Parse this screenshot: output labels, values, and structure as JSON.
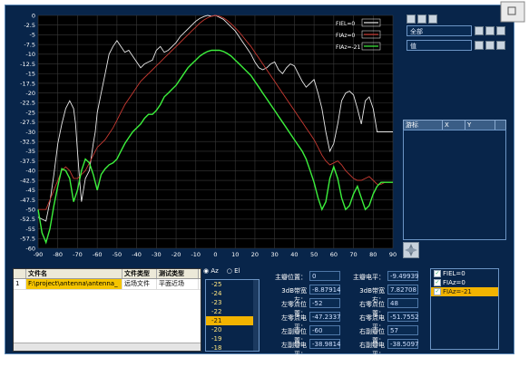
{
  "chart_data": {
    "type": "line",
    "xlim": [
      -90,
      90
    ],
    "ylim": [
      -60,
      0
    ],
    "x_ticks": [
      -90,
      -80,
      -70,
      -60,
      -50,
      -40,
      -30,
      -20,
      -10,
      0,
      10,
      20,
      30,
      40,
      50,
      60,
      70,
      80,
      90
    ],
    "y_ticks": [
      0,
      -2.5,
      -5,
      -7.5,
      -10,
      -12.5,
      -15,
      -17.5,
      -20,
      -22.5,
      -25,
      -27.5,
      -30,
      -32.5,
      -35,
      -37.5,
      -40,
      -42.5,
      -45,
      -47.5,
      -50,
      -52.5,
      -55,
      -57.5,
      -60
    ],
    "grid": true,
    "legend_position": "top-right",
    "series": [
      {
        "name": "FIEL=0",
        "color": "#e8e8e8",
        "x": [
          -90,
          -86,
          -84,
          -82,
          -80,
          -78,
          -76,
          -74,
          -72,
          -71,
          -70,
          -69,
          -68,
          -66,
          -64,
          -62,
          -61,
          -60,
          -58,
          -56,
          -54,
          -52,
          -50,
          -48,
          -46,
          -44,
          -42,
          -40,
          -38,
          -36,
          -34,
          -32,
          -30,
          -28,
          -26,
          -24,
          -22,
          -20,
          -18,
          -16,
          -14,
          -12,
          -10,
          -8,
          -6,
          -4,
          -2,
          0,
          2,
          4,
          6,
          8,
          10,
          12,
          14,
          16,
          18,
          20,
          22,
          24,
          26,
          28,
          30,
          32,
          34,
          36,
          38,
          40,
          42,
          44,
          46,
          48,
          50,
          52,
          54,
          56,
          58,
          60,
          62,
          64,
          66,
          68,
          70,
          72,
          74,
          76,
          78,
          80,
          82,
          84,
          86,
          88,
          90
        ],
        "y": [
          -52,
          -53,
          -48,
          -41,
          -33,
          -28,
          -24,
          -22,
          -24,
          -28,
          -35,
          -42,
          -48,
          -42,
          -40,
          -33,
          -30,
          -25,
          -20,
          -15,
          -10,
          -8,
          -6.5,
          -8,
          -9.5,
          -9,
          -10.5,
          -12,
          -13.5,
          -12.5,
          -12,
          -11.5,
          -9,
          -8,
          -9.5,
          -9,
          -8,
          -7,
          -5.5,
          -4.5,
          -3.5,
          -2.5,
          -1.5,
          -0.8,
          -0.3,
          0,
          -0.2,
          0,
          -0.5,
          -1,
          -2,
          -3,
          -4,
          -5.5,
          -7,
          -8.5,
          -10,
          -12,
          -13.5,
          -14,
          -13.5,
          -12.5,
          -12,
          -14,
          -15,
          -13.5,
          -12.5,
          -13,
          -15,
          -17,
          -18.5,
          -17.5,
          -16.5,
          -20,
          -24,
          -30,
          -35,
          -33,
          -28,
          -22,
          -20,
          -19.5,
          -20.5,
          -24,
          -28,
          -22,
          -21,
          -24,
          -30,
          -30,
          -30,
          -30,
          -30
        ]
      },
      {
        "name": "FIAz=0",
        "color": "#c83a32",
        "x": [
          -90,
          -86,
          -82,
          -78,
          -76,
          -74,
          -72,
          -70,
          -68,
          -66,
          -64,
          -62,
          -60,
          -58,
          -56,
          -54,
          -52,
          -50,
          -48,
          -46,
          -44,
          -42,
          -40,
          -38,
          -36,
          -34,
          -32,
          -30,
          -28,
          -26,
          -24,
          -22,
          -20,
          -18,
          -16,
          -14,
          -12,
          -10,
          -8,
          -6,
          -4,
          -2,
          0,
          2,
          4,
          6,
          8,
          10,
          12,
          14,
          16,
          18,
          20,
          22,
          24,
          26,
          28,
          30,
          32,
          34,
          36,
          38,
          40,
          42,
          44,
          46,
          48,
          50,
          52,
          54,
          56,
          58,
          60,
          62,
          64,
          66,
          68,
          70,
          72,
          74,
          76,
          78,
          80,
          82,
          84,
          86,
          88,
          90
        ],
        "y": [
          -50,
          -50,
          -45,
          -40,
          -39,
          -40,
          -42,
          -42,
          -41,
          -40,
          -38,
          -36,
          -34,
          -33,
          -32,
          -30.5,
          -29,
          -27,
          -25,
          -23,
          -21.5,
          -20,
          -18.5,
          -17,
          -16,
          -15,
          -14,
          -13,
          -12,
          -11,
          -10,
          -9,
          -8,
          -7,
          -6,
          -5,
          -4,
          -3,
          -2,
          -1.2,
          -0.6,
          -0.2,
          0,
          -0.2,
          -0.6,
          -1.3,
          -2.2,
          -3.2,
          -4.3,
          -5.5,
          -6.8,
          -8,
          -9.5,
          -11,
          -12.5,
          -14,
          -15.5,
          -17,
          -18.5,
          -20,
          -21.5,
          -23,
          -24.5,
          -26,
          -27.5,
          -29,
          -30.5,
          -32,
          -34,
          -36,
          -37.5,
          -38.5,
          -38,
          -37.5,
          -38.5,
          -40,
          -41,
          -42,
          -42.5,
          -42.5,
          -42,
          -41.5,
          -42.5,
          -43.5,
          -43.5,
          -43,
          -43,
          -43
        ]
      },
      {
        "name": "FIAz=-21",
        "color": "#3cf03c",
        "x": [
          -90,
          -88,
          -86,
          -84,
          -82,
          -80,
          -78,
          -76,
          -74,
          -72,
          -70,
          -68,
          -66,
          -64,
          -62,
          -60,
          -58,
          -56,
          -54,
          -52,
          -50,
          -48,
          -46,
          -44,
          -42,
          -40,
          -38,
          -36,
          -34,
          -32,
          -30,
          -28,
          -26,
          -24,
          -22,
          -20,
          -18,
          -16,
          -14,
          -12,
          -10,
          -8,
          -6,
          -4,
          -2,
          0,
          2,
          4,
          6,
          8,
          10,
          12,
          14,
          16,
          18,
          20,
          22,
          24,
          26,
          28,
          30,
          32,
          34,
          36,
          38,
          40,
          42,
          44,
          46,
          48,
          50,
          52,
          54,
          56,
          58,
          60,
          62,
          64,
          66,
          68,
          70,
          72,
          74,
          76,
          78,
          80,
          82,
          84,
          86,
          88,
          90
        ],
        "y": [
          -50,
          -56,
          -58.5,
          -55,
          -49,
          -44,
          -39.5,
          -40,
          -42,
          -48,
          -45,
          -40,
          -37,
          -38,
          -41,
          -45,
          -41,
          -39.5,
          -38.5,
          -38,
          -37,
          -35,
          -33,
          -31.5,
          -30,
          -29,
          -28,
          -26.5,
          -25.5,
          -25.5,
          -24.5,
          -23,
          -21,
          -20,
          -19,
          -18,
          -16.5,
          -15,
          -13.5,
          -12.5,
          -11.5,
          -10.5,
          -9.8,
          -9.3,
          -9,
          -9,
          -9,
          -9.3,
          -9.8,
          -10.5,
          -11.5,
          -12.5,
          -13.5,
          -14.5,
          -15.5,
          -17,
          -18.5,
          -20,
          -21.5,
          -23,
          -24.5,
          -26,
          -27.5,
          -29,
          -30.5,
          -32,
          -33.5,
          -35,
          -37,
          -40,
          -43,
          -47,
          -50,
          -48,
          -42,
          -39,
          -42,
          -47,
          -50,
          -49,
          -46,
          -44,
          -47,
          -50,
          -49,
          -46,
          -44,
          -43,
          -43,
          -43,
          -43
        ]
      }
    ]
  },
  "plot": {
    "bg": "#000000",
    "grid_color": "#3a3a3a"
  },
  "side": {
    "row1": "全部",
    "row2": "值",
    "table_cols": [
      "游标",
      "X",
      "Y"
    ]
  },
  "files": {
    "headers": [
      "文件名",
      "文件类型",
      "测试类型"
    ],
    "rows": [
      {
        "idx": "1",
        "name": "F:\\project\\antenna\\antenna_",
        "type": "远场文件",
        "test": "平面近场"
      }
    ]
  },
  "radio": {
    "az": "Az",
    "el": "El"
  },
  "angle_list": {
    "items": [
      "-25",
      "-24",
      "-23",
      "-22",
      "-21",
      "-20",
      "-19",
      "-18"
    ],
    "selected": "-21"
  },
  "metrics": {
    "main_pos_label": "主瓣位置：",
    "main_pos": "0",
    "main_level_label": "主瓣电平：",
    "main_level": "-9.49939",
    "bw3db_left_label": "3dB带宽左：",
    "bw3db_left": "-8.87914",
    "bw3db_right_label": "3dB带宽右：",
    "bw3db_right": "7.82708",
    "lzero_pos_label": "左零点位置：",
    "lzero_pos": "-52",
    "rzero_pos_label": "右零点位置：",
    "rzero_pos": "48",
    "lzero_level_label": "左零点电平：",
    "lzero_level": "-47.2337",
    "rzero_level_label": "右零点电平：",
    "rzero_level": "-51.7552",
    "lside_pos_label": "左副瓣位置：",
    "lside_pos": "-60",
    "rside_pos_label": "右副瓣位置：",
    "rside_pos": "57",
    "lside_level_label": "左副瓣电平：",
    "lside_level": "-38.9814",
    "rside_level_label": "右副瓣电平：",
    "rside_level": "-38.5097"
  },
  "legend_list": {
    "items": [
      "FIEL=0",
      "FIAz=0",
      "FIAz=-21"
    ],
    "selected": "FIAz=-21"
  }
}
